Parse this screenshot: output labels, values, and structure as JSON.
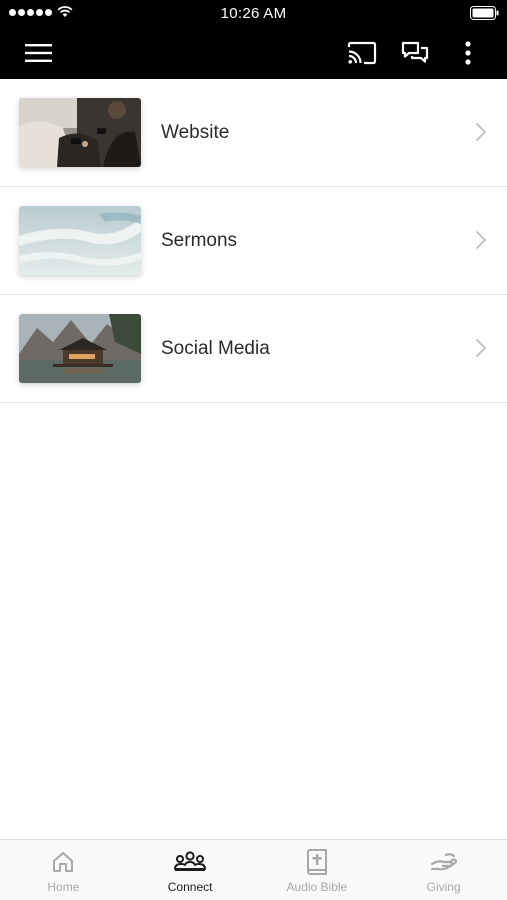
{
  "status_bar": {
    "time": "10:26 AM"
  },
  "header": {
    "icons": [
      "menu-icon",
      "cast-icon",
      "chat-icon",
      "more-vertical-icon"
    ]
  },
  "list": {
    "items": [
      {
        "label": "Website",
        "thumbnail": "people-with-phones-photo"
      },
      {
        "label": "Sermons",
        "thumbnail": "ocean-wave-photo"
      },
      {
        "label": "Social Media",
        "thumbnail": "lake-cabin-mountains-photo"
      }
    ]
  },
  "tab_bar": {
    "tabs": [
      {
        "label": "Home",
        "icon": "home-icon",
        "active": false
      },
      {
        "label": "Connect",
        "icon": "group-icon",
        "active": true
      },
      {
        "label": "Audio Bible",
        "icon": "bible-icon",
        "active": false
      },
      {
        "label": "Giving",
        "icon": "giving-hand-icon",
        "active": false
      }
    ]
  },
  "colors": {
    "header_background": "#000000",
    "active_tab_text": "#1c1c1c",
    "inactive_tab_text": "#a8a8a8",
    "row_text": "#2b2b2b",
    "divider": "#e6e6e6"
  }
}
